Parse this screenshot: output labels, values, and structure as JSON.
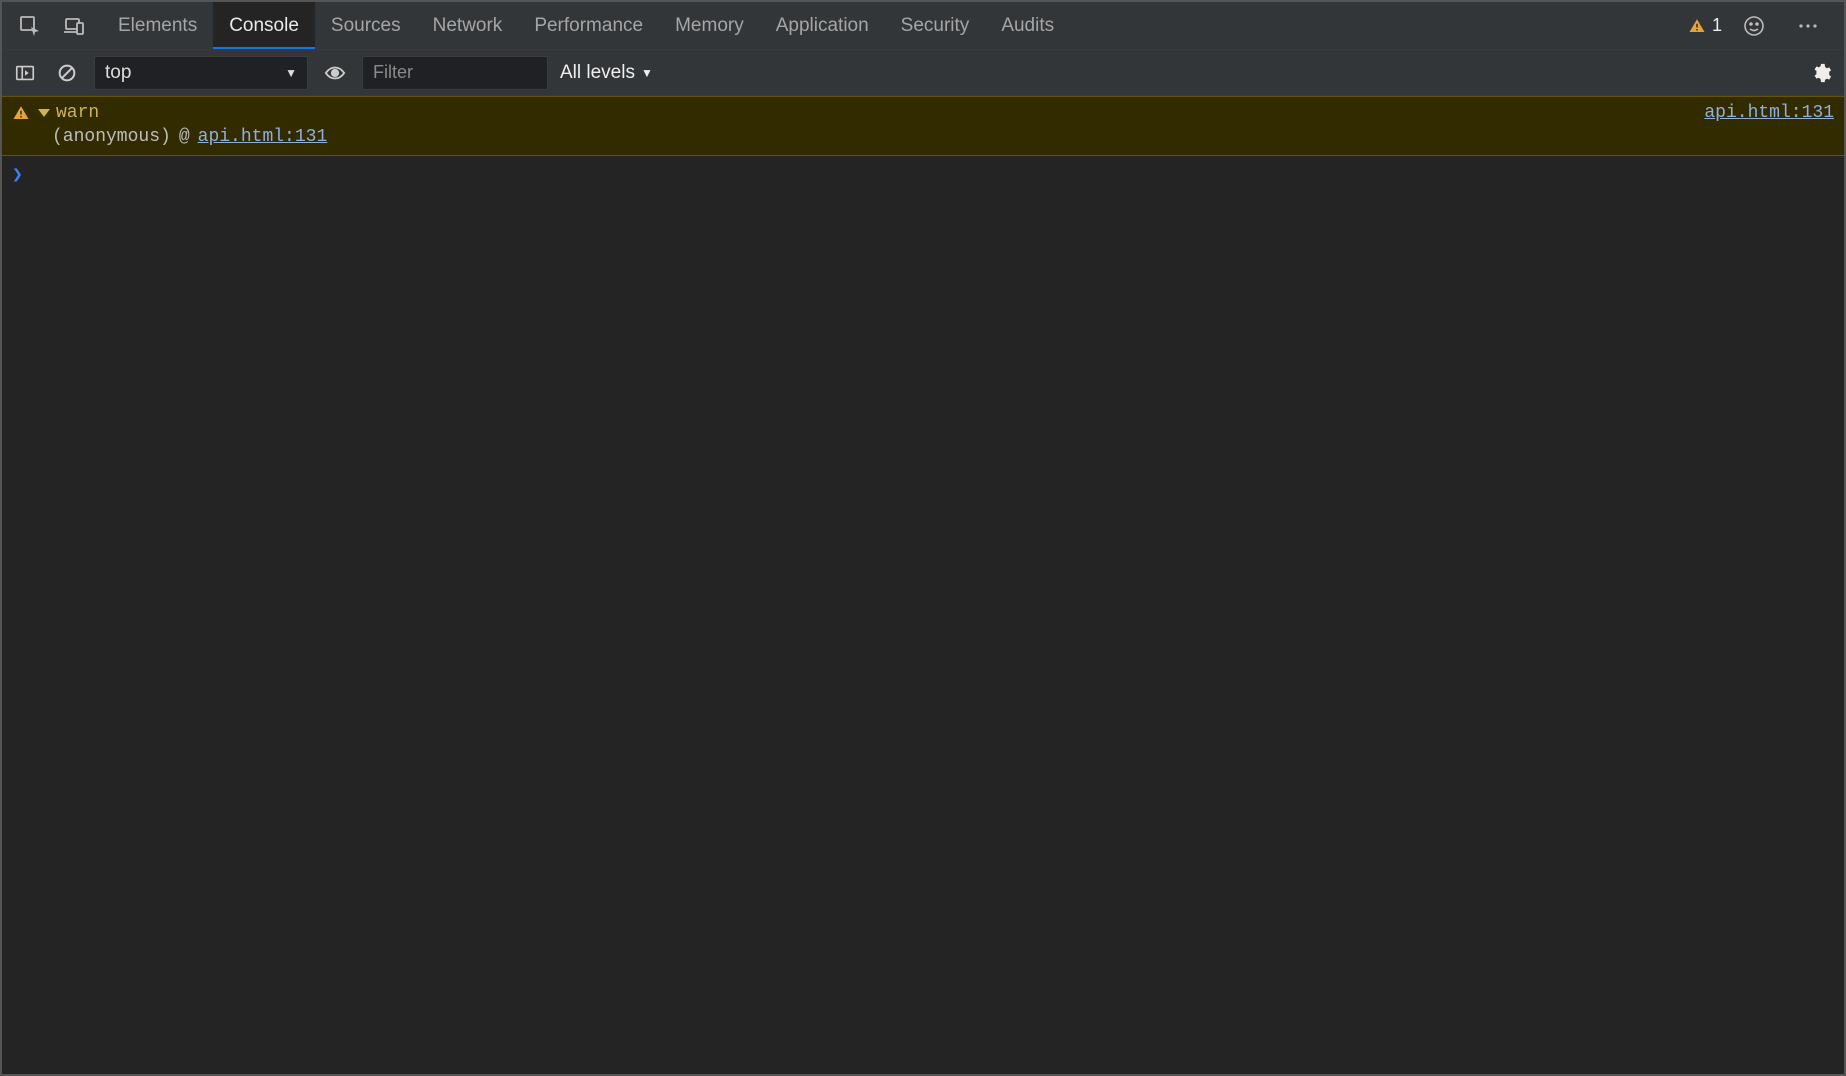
{
  "header": {
    "tabs": [
      {
        "label": "Elements",
        "active": false
      },
      {
        "label": "Console",
        "active": true
      },
      {
        "label": "Sources",
        "active": false
      },
      {
        "label": "Network",
        "active": false
      },
      {
        "label": "Performance",
        "active": false
      },
      {
        "label": "Memory",
        "active": false
      },
      {
        "label": "Application",
        "active": false
      },
      {
        "label": "Security",
        "active": false
      },
      {
        "label": "Audits",
        "active": false
      }
    ],
    "warning_count": "1"
  },
  "toolbar": {
    "context": "top",
    "filter_placeholder": "Filter",
    "levels_label": "All levels"
  },
  "console": {
    "messages": [
      {
        "type": "warning",
        "text": "warn",
        "source_link": "api.html:131",
        "stack": {
          "caller": "(anonymous)",
          "at": "@",
          "location": "api.html:131"
        }
      }
    ]
  }
}
